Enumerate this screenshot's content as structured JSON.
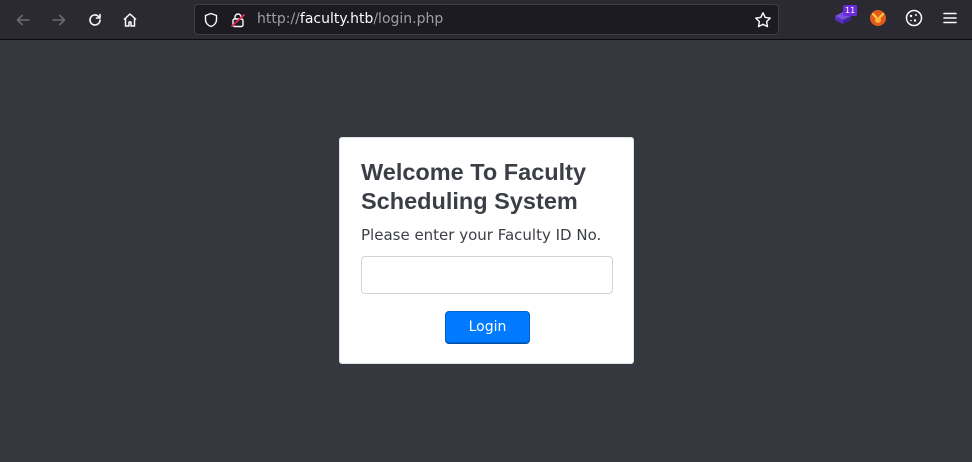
{
  "browser": {
    "url_scheme": "http://",
    "url_host": "faculty.htb",
    "url_path": "/login.php",
    "extension_badge": "11"
  },
  "login": {
    "title": "Welcome To Faculty Scheduling System",
    "label": "Please enter your Faculty ID No.",
    "input_value": "",
    "button_label": "Login"
  },
  "colors": {
    "toolbar_bg": "#2b2a33",
    "page_bg": "#363840",
    "button_primary": "#007bff"
  },
  "icons": [
    "back-arrow-icon",
    "forward-arrow-icon",
    "reload-icon",
    "home-icon",
    "shield-icon",
    "insecure-lock-icon",
    "bookmark-star-icon",
    "extension-icon",
    "fox-extension-icon",
    "cookie-icon",
    "hamburger-menu-icon"
  ]
}
